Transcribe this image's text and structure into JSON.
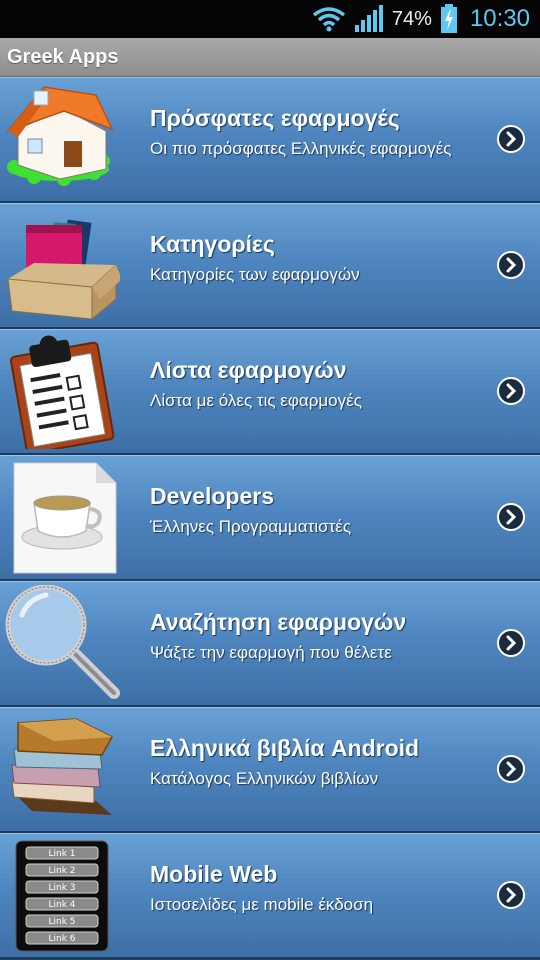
{
  "status": {
    "battery_percent": "74%",
    "time": "10:30"
  },
  "app_title": "Greek Apps",
  "items": [
    {
      "title": "Πρόσφατες εφαρμογές",
      "subtitle": "Οι πιο πρόσφατες Ελληνικές εφαρμογές",
      "icon": "house-icon"
    },
    {
      "title": "Κατηγορίες",
      "subtitle": "Κατηγορίες των εφαρμογών",
      "icon": "box-of-books-icon"
    },
    {
      "title": "Λίστα εφαρμογών",
      "subtitle": "Λίστα με όλες τις εφαρμογές",
      "icon": "clipboard-icon"
    },
    {
      "title": "Developers",
      "subtitle": "Έλληνες Προγραμματιστές",
      "icon": "coffee-cup-icon"
    },
    {
      "title": "Αναζήτηση εφαρμογών",
      "subtitle": "Ψάξτε την εφαρμογή που θέλετε",
      "icon": "magnifier-icon"
    },
    {
      "title": "Ελληνικά βιβλία Android",
      "subtitle": "Κατάλογος Ελληνικών βιβλίων",
      "icon": "book-stack-icon"
    },
    {
      "title": "Mobile Web",
      "subtitle": "Ιστοσελίδες με mobile έκδοση",
      "icon": "links-icon",
      "icon_labels": [
        "Link 1",
        "Link 2",
        "Link 3",
        "Link 4",
        "Link 5",
        "Link 6"
      ]
    }
  ]
}
